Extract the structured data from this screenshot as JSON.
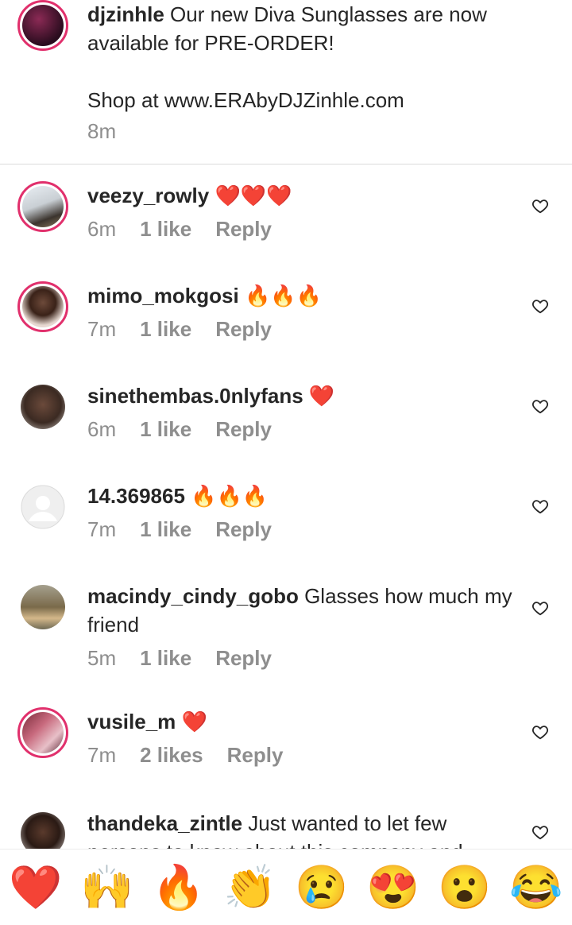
{
  "caption": {
    "username": "djzinhle",
    "text_line1": "Our new Diva Sunglasses are now available for PRE-ORDER!",
    "text_line2": "Shop at www.ERAbyDJZinhle.com",
    "time": "8m"
  },
  "comments": [
    {
      "username": "veezy_rowly",
      "text": "❤️❤️❤️",
      "time": "6m",
      "likes": "1 like",
      "reply": "Reply"
    },
    {
      "username": "mimo_mokgosi",
      "text": "🔥🔥🔥",
      "time": "7m",
      "likes": "1 like",
      "reply": "Reply"
    },
    {
      "username": "sinethembas.0nlyfans",
      "text": "❤️",
      "time": "6m",
      "likes": "1 like",
      "reply": "Reply"
    },
    {
      "username": "14.369865",
      "text": "🔥🔥🔥",
      "time": "7m",
      "likes": "1 like",
      "reply": "Reply"
    },
    {
      "username": "macindy_cindy_gobo",
      "text": "Glasses how much my friend",
      "time": "5m",
      "likes": "1 like",
      "reply": "Reply"
    },
    {
      "username": "vusile_m",
      "text": "❤️",
      "time": "7m",
      "likes": "2 likes",
      "reply": "Reply"
    },
    {
      "username": "thandeka_zintle",
      "text": "Just wanted to let few persons to know about this company and",
      "time": "",
      "likes": "",
      "reply": ""
    }
  ],
  "emoji_bar": [
    "❤️",
    "🙌",
    "🔥",
    "👏",
    "😢",
    "😍",
    "😮",
    "😂"
  ],
  "colors": {
    "story_ring": "#e1306c",
    "secondary_text": "#8e8e8e",
    "divider": "#dbdbdb"
  }
}
